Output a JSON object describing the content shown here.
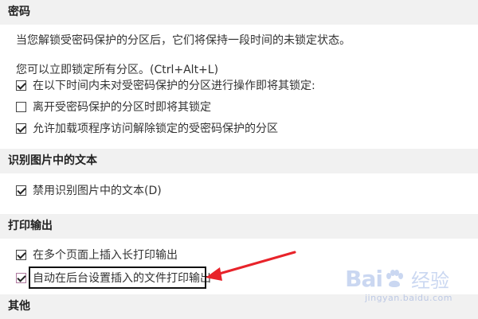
{
  "sections": {
    "password": {
      "title": "密码",
      "description": "当您解锁受密码保护的分区后，它们将保持一段时间的未锁定状态。",
      "lock_hint": "您可以立即锁定所有分区。(Ctrl+Alt+L)",
      "options": [
        {
          "label": "在以下时间内未对受密码保护的分区进行操作即将其锁定:",
          "checked": true
        },
        {
          "label": "离开受密码保护的分区时即将其锁定",
          "checked": false
        },
        {
          "label": "允许加载项程序访问解除锁定的受密码保护的分区",
          "checked": true
        }
      ]
    },
    "ocr": {
      "title": "识别图片中的文本",
      "options": [
        {
          "label": "禁用识别图片中的文本(D)",
          "checked": true
        }
      ]
    },
    "printout": {
      "title": "打印输出",
      "options": [
        {
          "label": "在多个页面上插入长打印输出",
          "checked": true
        },
        {
          "label": "自动在后台设置插入的文件打印输出",
          "checked": true
        }
      ]
    },
    "other": {
      "title": "其他"
    }
  },
  "watermark": {
    "brand_a": "Bai",
    "brand_b": "",
    "brand_cn": "经验",
    "url": "jingyan.baidu.com"
  },
  "colors": {
    "section_bg": "#f1f1f1",
    "arrow": "#e8232a",
    "highlight_border": "#111111",
    "watermark": "#6a8fd8"
  }
}
